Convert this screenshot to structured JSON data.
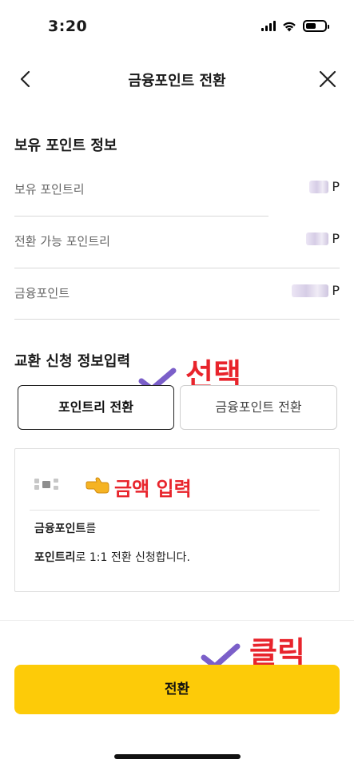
{
  "status_bar": {
    "time": "3:20"
  },
  "nav": {
    "title": "금융포인트 전환"
  },
  "holding_section": {
    "title": "보유 포인트 정보",
    "rows": [
      {
        "label": "보유 포인트리",
        "unit": "P"
      },
      {
        "label": "전환 가능 포인트리",
        "unit": "P"
      },
      {
        "label": "금융포인트",
        "unit": "P"
      }
    ]
  },
  "exchange_section": {
    "title": "교환 신청 정보입력",
    "tabs": [
      {
        "label": "포인트리 전환",
        "active": true
      },
      {
        "label": "금융포인트 전환",
        "active": false
      }
    ]
  },
  "amount_card": {
    "line1_bold": "금융포인트",
    "line1_rest": "를",
    "line2_bold": "포인트리",
    "line2_rest": "로 1:1 전환 신청합니다."
  },
  "annotations": {
    "select": "선택",
    "amount": "금액 입력",
    "click": "클릭",
    "accent_color": "#e8242c",
    "check_color": "#7b5fc9"
  },
  "convert_button": {
    "label": "전환",
    "color": "#fdcb08"
  }
}
